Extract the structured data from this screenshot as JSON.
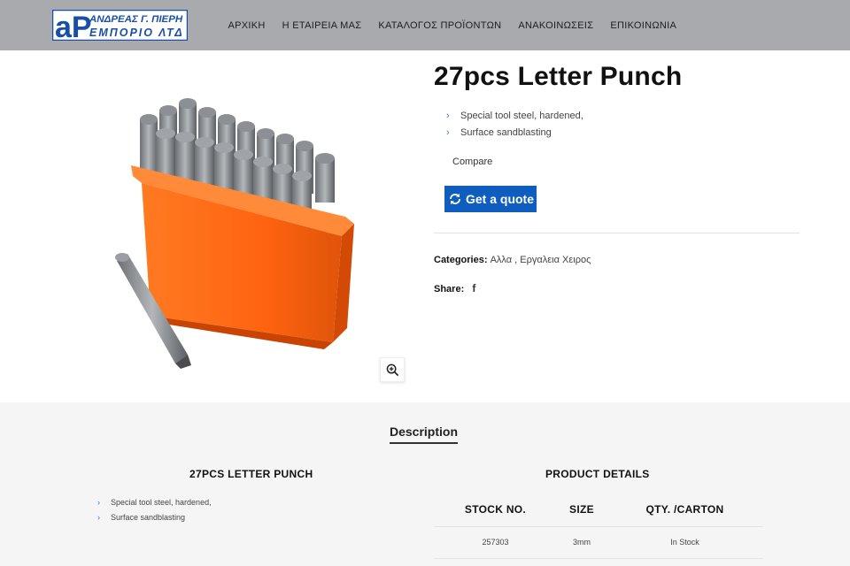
{
  "header": {
    "logo": {
      "line1": "ΑΝΔΡΕΑΣ Γ. ΠΙΕΡΗ",
      "line2": "ΕΜΠΟΡΙΟ ΛΤΔ",
      "mark": "aP"
    },
    "nav": [
      "ΑΡΧΙΚΗ",
      "Η ΕΤΑΙΡΕΙΑ ΜΑΣ",
      "ΚΑΤΑΛΟΓΟΣ ΠΡΟΪΟΝΤΩΝ",
      "ΑΝΑΚΟΙΝΩΣΕΙΣ",
      "ΕΠΙΚΟΙΝΩΝΙΑ"
    ]
  },
  "product": {
    "title": "27pcs Letter Punch",
    "features": [
      "Special tool steel, hardened,",
      "Surface sandblasting"
    ],
    "compare_label": "Compare",
    "quote_label": "Get a quote",
    "categories_label": "Categories:",
    "categories": [
      "Αλλα",
      "Εργαλεια Χειρος"
    ],
    "share_label": "Share:",
    "share_icon": "facebook-icon"
  },
  "tabs": {
    "description": "Description"
  },
  "description": {
    "title": "27PCS LETTER PUNCH",
    "items": [
      "Special tool steel, hardened,",
      "Surface sandblasting"
    ]
  },
  "details": {
    "title": "PRODUCT DETAILS",
    "columns": [
      "STOCK NO.",
      "SIZE",
      "QTY. /CARTON"
    ],
    "rows": [
      [
        "257303",
        "3mm",
        "In Stock"
      ]
    ]
  },
  "colors": {
    "header_bg": "#a9aaad",
    "logo_blue": "#1a4fa8",
    "quote_btn": "#0f5dbf",
    "accent": "#2f6fd6",
    "case_orange": "#ff6a1a"
  }
}
